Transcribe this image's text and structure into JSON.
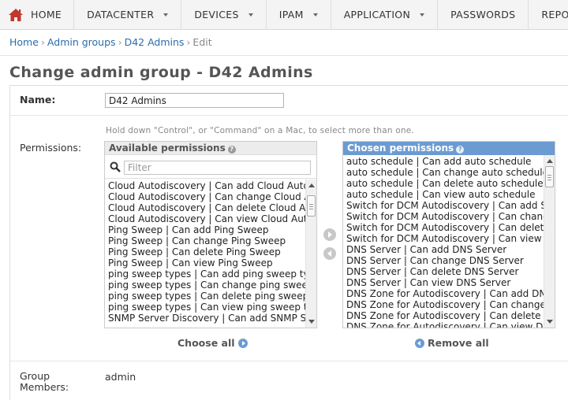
{
  "nav": {
    "home": "HOME",
    "items": [
      "DATACENTER",
      "DEVICES",
      "IPAM",
      "APPLICATION",
      "PASSWORDS",
      "REPORTS"
    ]
  },
  "breadcrumb": {
    "home": "Home",
    "admin_groups": "Admin groups",
    "group": "D42 Admins",
    "current": "Edit",
    "separator": "›"
  },
  "page_title": "Change admin group - D42 Admins",
  "form": {
    "name_label": "Name:",
    "name_value": "D42 Admins",
    "help_text": "Hold down \"Control\", or \"Command\" on a Mac, to select more than one.",
    "permissions_label": "Permissions:",
    "group_members_label": "Group Members:",
    "group_members_value": "admin"
  },
  "available": {
    "title": "Available permissions",
    "help": "?",
    "filter_placeholder": "Filter",
    "options": [
      "Cloud Autodiscovery | Can add Cloud Autodiscovery",
      "Cloud Autodiscovery | Can change Cloud Autodiscovery",
      "Cloud Autodiscovery | Can delete Cloud Autodiscovery",
      "Cloud Autodiscovery | Can view Cloud Autodiscovery",
      "Ping Sweep | Can add Ping Sweep",
      "Ping Sweep | Can change Ping Sweep",
      "Ping Sweep | Can delete Ping Sweep",
      "Ping Sweep | Can view Ping Sweep",
      "ping sweep types | Can add ping sweep types",
      "ping sweep types | Can change ping sweep types",
      "ping sweep types | Can delete ping sweep types",
      "ping sweep types | Can view ping sweep types",
      "SNMP Server Discovery | Can add SNMP Server Discovery"
    ],
    "choose_all": "Choose all"
  },
  "chosen": {
    "title": "Chosen permissions",
    "help": "?",
    "options": [
      "auto schedule | Can add auto schedule",
      "auto schedule | Can change auto schedule",
      "auto schedule | Can delete auto schedule",
      "auto schedule | Can view auto schedule",
      "Switch for DCM Autodiscovery | Can add Switch",
      "Switch for DCM Autodiscovery | Can change Switch",
      "Switch for DCM Autodiscovery | Can delete Switch",
      "Switch for DCM Autodiscovery | Can view Switch",
      "DNS Server | Can add DNS Server",
      "DNS Server | Can change DNS Server",
      "DNS Server | Can delete DNS Server",
      "DNS Server | Can view DNS Server",
      "DNS Zone for Autodiscovery | Can add DNS Zone",
      "DNS Zone for Autodiscovery | Can change DNS Zone",
      "DNS Zone for Autodiscovery | Can delete DNS Zone",
      "DNS Zone for Autodiscovery | Can view DNS Zone"
    ],
    "remove_all": "Remove all"
  },
  "colors": {
    "link": "#2a6cae",
    "chosen_header": "#6c9bd2",
    "home_icon": "#c0392b"
  }
}
